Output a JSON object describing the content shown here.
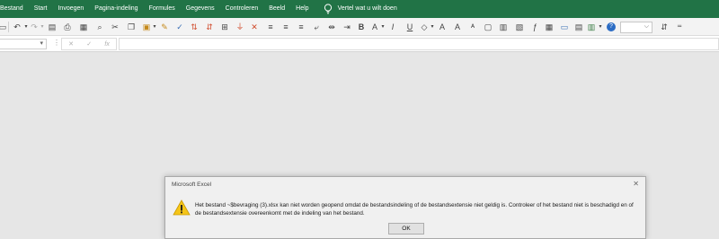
{
  "menu": {
    "items": [
      "Bestand",
      "Start",
      "Invoegen",
      "Pagina-indeling",
      "Formules",
      "Gegevens",
      "Controleren",
      "Beeld",
      "Help"
    ],
    "tell_me": "Vertel wat u wilt doen",
    "bg_color": "#217346"
  },
  "toolbar": {
    "icons": [
      "save-icon",
      "undo-icon",
      "redo-icon",
      "print-preview-icon",
      "print-icon",
      "grid-icon",
      "find-icon",
      "cut-icon",
      "copy-icon",
      "paste-icon",
      "format-painter-icon",
      "spelling-icon",
      "sort-asc-icon",
      "sort-desc-icon",
      "autosum-icon",
      "clear-icon",
      "align-left-icon",
      "align-center-icon",
      "align-right-icon",
      "wrap-icon",
      "merge-icon",
      "indent-icon",
      "bold-icon",
      "font-color-icon",
      "italic-icon",
      "underline-icon",
      "increase-font-icon",
      "decrease-font-icon",
      "fill-color-icon",
      "border-icon",
      "number-format-icon",
      "insert-function-icon",
      "table-icon",
      "conditional-format-icon",
      "help-icon",
      "font-size-icon",
      "more-icon"
    ]
  },
  "formula_bar": {
    "cancel": "✕",
    "enter": "✓",
    "function": "fx"
  },
  "dialog": {
    "title": "Microsoft Excel",
    "message": "Het bestand ~$bevraging (3).xlsx kan niet worden geopend omdat de bestandsindeling of de bestandsextensie niet geldig is. Controleer of het bestand niet is beschadigd en of de bestandsextensie overeenkomt met de indeling van het bestand.",
    "ok_label": "OK"
  }
}
